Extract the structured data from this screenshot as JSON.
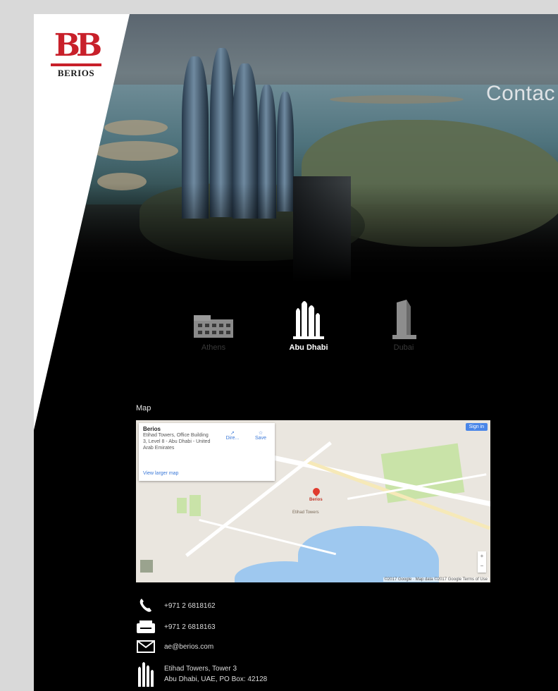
{
  "brand": {
    "logo_text": "BERIOS",
    "logo_mark": "BB",
    "accent_color": "#c8202a"
  },
  "page": {
    "title": "Contac"
  },
  "offices": [
    {
      "label": "Athens",
      "icon": "building-icon",
      "active": false
    },
    {
      "label": "Abu Dhabi",
      "icon": "towers-icon",
      "active": true
    },
    {
      "label": "Dubai",
      "icon": "skyscraper-icon",
      "active": false
    }
  ],
  "map": {
    "label": "Map",
    "card_title": "Berios",
    "card_address": "Etihad Towers, Office Building 3, Level 8 - Abu Dhabi - United Arab Emirates",
    "directions_label": "Dire...",
    "save_label": "Save",
    "larger_map_link": "View larger map",
    "signin_label": "Sign in",
    "credit": "©2017 Google · Map data ©2017 Google  Terms of Use",
    "pin_label": "Berios",
    "place_label": "Etihad Towers"
  },
  "contact": {
    "phone": "+971 2 6818162",
    "fax": "+971 2 6818163",
    "email": "ae@berios.com",
    "address_line1": "Etihad Towers, Tower 3",
    "address_line2": "Abu Dhabi, UAE, PO Box: 42128"
  }
}
